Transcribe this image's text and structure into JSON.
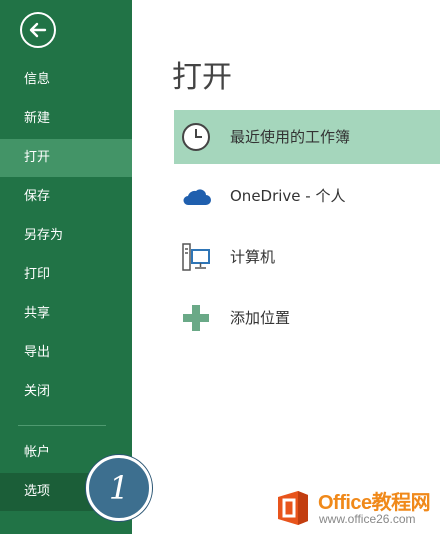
{
  "sidebar": {
    "back_icon": "back-arrow-icon",
    "items": [
      {
        "label": "信息"
      },
      {
        "label": "新建"
      },
      {
        "label": "打开",
        "active": true
      },
      {
        "label": "保存"
      },
      {
        "label": "另存为"
      },
      {
        "label": "打印"
      },
      {
        "label": "共享"
      },
      {
        "label": "导出"
      },
      {
        "label": "关闭"
      },
      {
        "label": "帐户"
      },
      {
        "label": "选项"
      }
    ]
  },
  "callout": {
    "number": "1"
  },
  "main": {
    "title": "打开",
    "locations": [
      {
        "label": "最近使用的工作簿",
        "icon": "clock-icon",
        "active": true
      },
      {
        "label": "OneDrive - 个人",
        "icon": "cloud-icon"
      },
      {
        "label": "计算机",
        "icon": "computer-icon"
      },
      {
        "label": "添加位置",
        "icon": "plus-icon"
      }
    ]
  },
  "watermark": {
    "title": "Office教程网",
    "url": "www.office26.com",
    "icon": "office-logo-icon"
  },
  "colors": {
    "sidebar_bg": "#217346",
    "sidebar_active": "#439467",
    "location_active": "#a5d6bc",
    "callout": "#3d6f8f",
    "watermark_orange": "#f0891a"
  }
}
